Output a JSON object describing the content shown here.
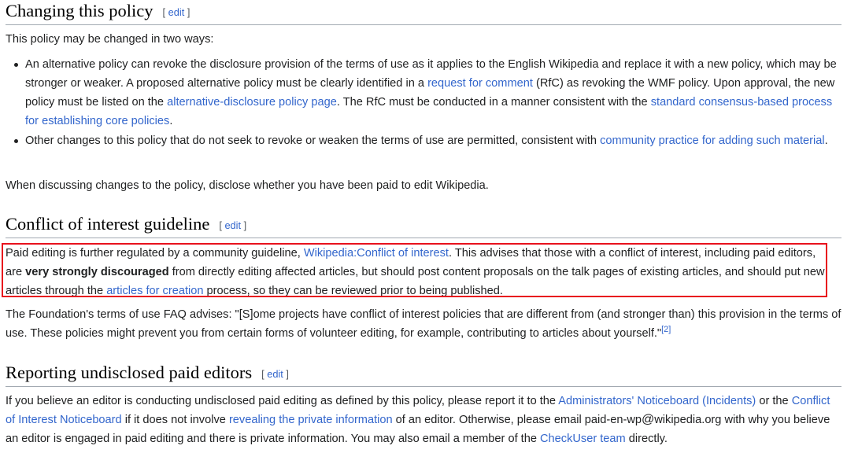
{
  "sections": {
    "changing": {
      "title": "Changing this policy",
      "edit_label": "edit",
      "intro": "This policy may be changed in two ways:",
      "bullet1": {
        "t1": "An alternative policy can revoke the disclosure provision of the terms of use as it applies to the English Wikipedia and replace it with a new policy, which may be stronger or weaker. A proposed alternative policy must be clearly identified in a ",
        "link1": "request for comment",
        "t2": " (RfC) as revoking the WMF policy. Upon approval, the new policy must be listed on the ",
        "link2": "alternative-disclosure policy page",
        "t3": ". The RfC must be conducted in a manner consistent with the ",
        "link3": "standard consensus-based process for establishing core policies",
        "t4": "."
      },
      "bullet2": {
        "t1": "Other changes to this policy that do not seek to revoke or weaken the terms of use are permitted, consistent with ",
        "link1": "community practice for adding such material",
        "t2": "."
      },
      "closing": "When discussing changes to the policy, disclose whether you have been paid to edit Wikipedia."
    },
    "coi": {
      "title": "Conflict of interest guideline",
      "edit_label": "edit",
      "p1": {
        "t1": "Paid editing is further regulated by a community guideline, ",
        "link1": "Wikipedia:Conflict of interest",
        "t2": ". This advises that those with a conflict of interest, including paid editors, are ",
        "bold": "very strongly discouraged",
        "t3": " from directly editing affected articles, but should post content proposals on the talk pages of existing articles, and should put new articles through the ",
        "link2": "articles for creation",
        "t4": " process, so they can be reviewed prior to being published."
      },
      "p2": {
        "t1": "The Foundation's terms of use FAQ advises: \"[S]ome projects have conflict of interest policies that are different from (and stronger than) this provision in the terms of use. These policies might prevent you from certain forms of volunteer editing, for example, contributing to articles about yourself.\"",
        "ref": "[2]"
      }
    },
    "reporting": {
      "title": "Reporting undisclosed paid editors",
      "edit_label": "edit",
      "p1": {
        "t1": "If you believe an editor is conducting undisclosed paid editing as defined by this policy, please report it to the ",
        "link1": "Administrators' Noticeboard (Incidents)",
        "t2": " or the ",
        "link2": "Conflict of Interest Noticeboard",
        "t3": " if it does not involve ",
        "link3": "revealing the private information",
        "t4": " of an editor. Otherwise, please email paid-en-wp",
        "at": "@",
        "t5": "wikipedia.org with why you believe an editor is engaged in paid editing and there is private information. You may also email a member of the ",
        "link4": "CheckUser team",
        "t6": " directly."
      }
    }
  },
  "colors": {
    "link": "#3366cc",
    "text": "#202122",
    "highlight_border": "#e8111d"
  }
}
